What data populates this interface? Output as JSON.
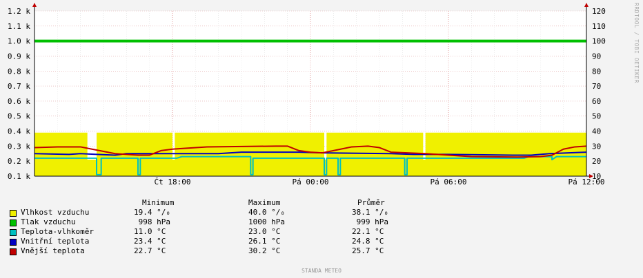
{
  "watermark": "RRDTOOL / TOBI OETIKER",
  "footer": "STANDA METEO",
  "chart_data": {
    "type": "area",
    "x_ticks": [
      "Čt 18:00",
      "Pá 00:00",
      "Pá 06:00",
      "Pá 12:00"
    ],
    "x_tick_hours": [
      6,
      12,
      18,
      24
    ],
    "x_range_hours": [
      0,
      24
    ],
    "left_axis": {
      "labels": [
        "0.1 k",
        "0.2 k",
        "0.3 k",
        "0.4 k",
        "0.5 k",
        "0.6 k",
        "0.7 k",
        "0.8 k",
        "0.9 k",
        "1.0 k",
        "1.1 k",
        "1.2 k"
      ],
      "min": 100,
      "max": 1200
    },
    "right_axis": {
      "labels": [
        "10",
        "20",
        "30",
        "40",
        "50",
        "60",
        "70",
        "80",
        "90",
        "100",
        "110",
        "120"
      ],
      "min": 10,
      "max": 120
    },
    "grid": true,
    "series": [
      {
        "name": "Vlhkost vzduchu",
        "color": "#f0f000",
        "style": "area",
        "axis": "right",
        "summary": {
          "min": "19.4 °/₀",
          "max": "40.0 °/₀",
          "avg": "38.1 °/₀"
        },
        "points": [
          [
            0,
            39
          ],
          [
            2.3,
            39
          ],
          [
            2.3,
            21
          ],
          [
            2.7,
            21
          ],
          [
            2.7,
            39
          ],
          [
            6.0,
            39
          ],
          [
            6.0,
            21
          ],
          [
            6.1,
            21
          ],
          [
            6.1,
            39
          ],
          [
            12.6,
            39
          ],
          [
            12.6,
            21
          ],
          [
            12.7,
            21
          ],
          [
            12.7,
            39
          ],
          [
            16.9,
            39
          ],
          [
            16.9,
            21
          ],
          [
            17.0,
            21
          ],
          [
            17.0,
            39
          ],
          [
            24,
            39
          ]
        ]
      },
      {
        "name": "Tlak vzduchu",
        "color": "#00c000",
        "style": "line",
        "axis": "left",
        "summary": {
          "min": " 998 hPa",
          "max": "1000 hPa",
          "avg": " 999 hPa"
        },
        "points": [
          [
            0,
            1000
          ],
          [
            24,
            1000
          ]
        ]
      },
      {
        "name": "Teplota-vlhkoměr",
        "color": "#00c0c0",
        "style": "line",
        "axis": "right",
        "summary": {
          "min": "11.0 °C",
          "max": "23.0 °C",
          "avg": "22.1 °C"
        },
        "points": [
          [
            0,
            22
          ],
          [
            2.7,
            22
          ],
          [
            2.7,
            11
          ],
          [
            2.9,
            11
          ],
          [
            2.9,
            22
          ],
          [
            4.5,
            22
          ],
          [
            4.5,
            11
          ],
          [
            4.6,
            11
          ],
          [
            4.6,
            22
          ],
          [
            6.2,
            22
          ],
          [
            6.4,
            23
          ],
          [
            9.4,
            23
          ],
          [
            9.4,
            11
          ],
          [
            9.5,
            11
          ],
          [
            9.5,
            22
          ],
          [
            12.6,
            22
          ],
          [
            12.6,
            11
          ],
          [
            12.7,
            11
          ],
          [
            12.7,
            22
          ],
          [
            13.2,
            22
          ],
          [
            13.2,
            11
          ],
          [
            13.3,
            11
          ],
          [
            13.3,
            22
          ],
          [
            16.1,
            22
          ],
          [
            16.1,
            11
          ],
          [
            16.2,
            11
          ],
          [
            16.2,
            22
          ],
          [
            18.5,
            22
          ],
          [
            21.3,
            22
          ],
          [
            21.5,
            23
          ],
          [
            22.5,
            23
          ],
          [
            22.5,
            21
          ],
          [
            22.7,
            23
          ],
          [
            24,
            23
          ]
        ]
      },
      {
        "name": "Vnitřní teplota",
        "color": "#0000c0",
        "style": "line",
        "axis": "right",
        "summary": {
          "min": "23.4 °C",
          "max": "26.1 °C",
          "avg": "24.8 °C"
        },
        "points": [
          [
            0,
            25
          ],
          [
            1.5,
            24.5
          ],
          [
            2.0,
            25
          ],
          [
            3.5,
            24
          ],
          [
            4.0,
            25
          ],
          [
            8.0,
            25
          ],
          [
            9.0,
            26
          ],
          [
            11.5,
            26
          ],
          [
            12.5,
            25.5
          ],
          [
            15.5,
            25
          ],
          [
            16.5,
            24.5
          ],
          [
            18.0,
            24.5
          ],
          [
            20.8,
            24
          ],
          [
            21.6,
            24
          ],
          [
            22.4,
            25
          ],
          [
            24,
            26
          ]
        ]
      },
      {
        "name": "Vnější teplota",
        "color": "#c00000",
        "style": "line",
        "axis": "right",
        "summary": {
          "min": "22.7 °C",
          "max": "30.2 °C",
          "avg": "25.7 °C"
        },
        "points": [
          [
            0,
            29
          ],
          [
            1,
            29.5
          ],
          [
            2.0,
            29.5
          ],
          [
            2.5,
            28
          ],
          [
            3.5,
            25
          ],
          [
            4.5,
            24
          ],
          [
            5.0,
            24
          ],
          [
            5.5,
            27
          ],
          [
            6.0,
            28
          ],
          [
            6.5,
            28.5
          ],
          [
            7.5,
            29.5
          ],
          [
            10.5,
            30
          ],
          [
            11.0,
            30
          ],
          [
            11.5,
            27
          ],
          [
            12.0,
            26
          ],
          [
            12.5,
            25.5
          ],
          [
            13.0,
            27
          ],
          [
            13.8,
            29.5
          ],
          [
            14.5,
            30
          ],
          [
            15.0,
            29
          ],
          [
            15.5,
            26
          ],
          [
            17.0,
            25
          ],
          [
            19.0,
            23
          ],
          [
            21.0,
            22.7
          ],
          [
            22.0,
            23
          ],
          [
            22.5,
            24
          ],
          [
            23.0,
            28
          ],
          [
            23.5,
            29.5
          ],
          [
            24,
            30
          ]
        ]
      }
    ],
    "legend_headers": {
      "min": "Minimum",
      "max": "Maximum",
      "avg": "Průměr"
    }
  }
}
